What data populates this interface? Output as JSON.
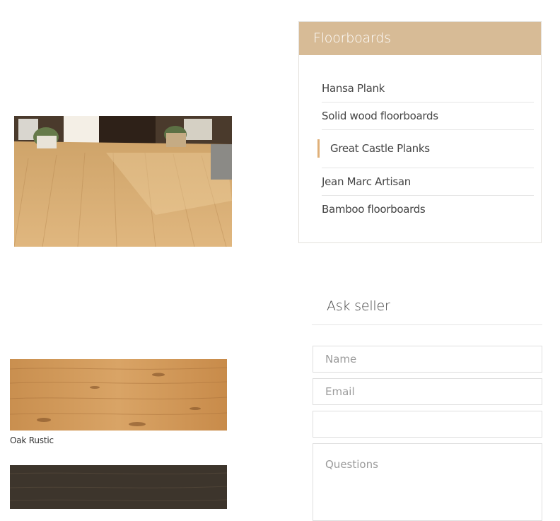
{
  "floorboards": {
    "title": "Floorboards",
    "items": [
      {
        "label": "Hansa Plank",
        "active": false
      },
      {
        "label": "Solid wood floorboards",
        "active": false
      },
      {
        "label": "Great Castle Planks",
        "active": true
      },
      {
        "label": "Jean Marc Artisan",
        "active": false
      },
      {
        "label": "Bamboo floorboards",
        "active": false
      }
    ],
    "accent_color": "#d7bb96",
    "active_marker_color": "#e0b079"
  },
  "gallery": {
    "room_photo_icon": "wood-floor-room-photo",
    "swatches": [
      {
        "caption": "Oak Rustic",
        "icon": "light-oak-swatch"
      },
      {
        "caption": "",
        "icon": "dark-wood-swatch"
      }
    ]
  },
  "ask_seller": {
    "title": "Ask seller",
    "name_placeholder": "Name",
    "email_placeholder": "Email",
    "phone_placeholder": "",
    "questions_placeholder": "Questions"
  }
}
